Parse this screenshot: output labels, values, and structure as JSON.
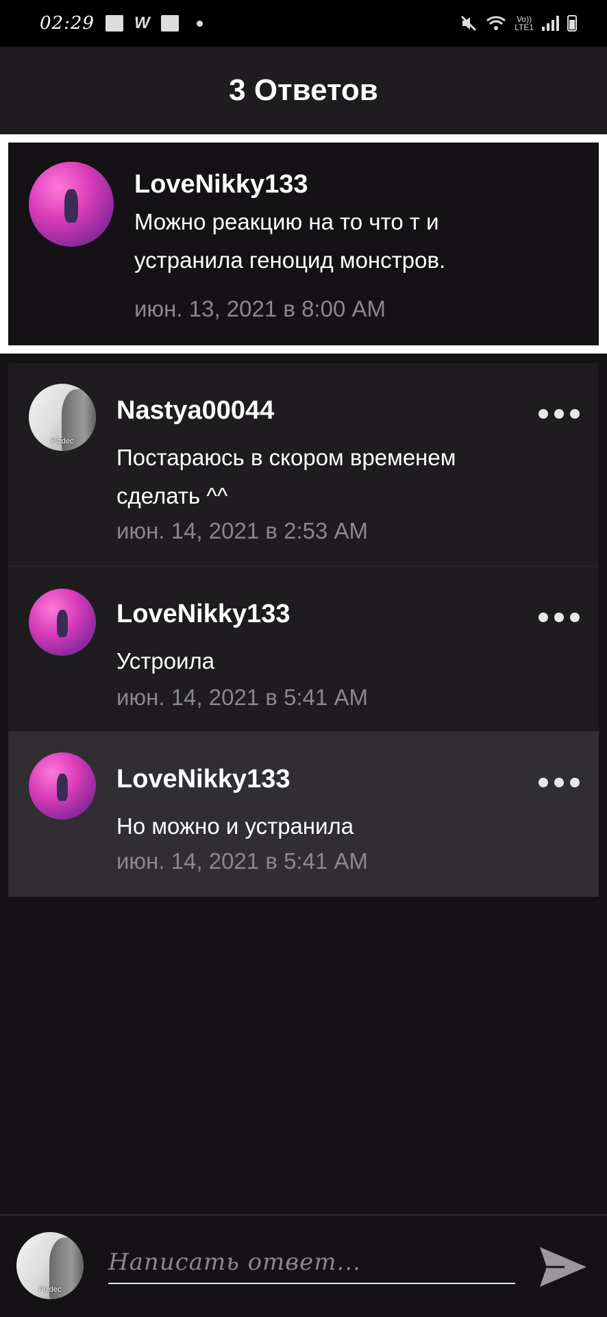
{
  "status_bar": {
    "time": "02:29",
    "network_label_top": "Vo))",
    "network_label_bottom": "LTE1"
  },
  "header": {
    "title": "3 Ответов"
  },
  "original_comment": {
    "username": "LoveNikky133",
    "text_line1": "Можно реакцию на то что т и",
    "text_line2": "устранила геноцид монстров.",
    "timestamp": "июн. 13, 2021 в 8:00 AM",
    "avatar": "glitter-avatar"
  },
  "replies": [
    {
      "username": "Nastya00044",
      "text_line1": "Постараюсь в скором временем",
      "text_line2": "сделать ^^",
      "timestamp": "июн. 14, 2021 в 2:53 AM",
      "avatar": "moai-avatar",
      "avatar_caption": "Pizdec"
    },
    {
      "username": "LoveNikky133",
      "text_line1": "Устроила",
      "timestamp": "июн. 14, 2021 в 5:41 AM",
      "avatar": "glitter-avatar"
    },
    {
      "username": "LoveNikky133",
      "text_line1": "Но можно и устранила",
      "timestamp": "июн. 14, 2021 в 5:41 AM",
      "avatar": "glitter-avatar",
      "highlighted": true
    }
  ],
  "composer": {
    "placeholder": "Написать ответ...",
    "avatar_caption": "Pizdec",
    "send_icon": "send-icon"
  },
  "colors": {
    "background": "#141215",
    "card": "#1e1c1f",
    "highlight": "#302e33",
    "timestamp": "#8a878d"
  }
}
